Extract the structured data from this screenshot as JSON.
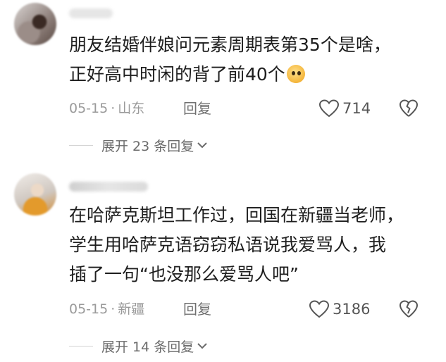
{
  "comments": [
    {
      "text_lines": [
        "朋友结婚伴娘问元素周期表第35个是啥，",
        "正好高中时闲的背了前40个"
      ],
      "emoji_icon": "grimace-emoji-icon",
      "date": "05-15",
      "dot": "·",
      "location": "山东",
      "reply_label": "回复",
      "likes": "714",
      "expand_label": "展开 23 条回复"
    },
    {
      "text_lines": [
        "在哈萨克斯坦工作过，回国在新疆当老师，",
        "学生用哈萨克语窃窃私语说我爱骂人，我",
        "插了一句“也没那么爱骂人吧”"
      ],
      "date": "05-15",
      "dot": "·",
      "location": "新疆",
      "reply_label": "回复",
      "likes": "3186",
      "expand_label": "展开 14 条回复"
    }
  ],
  "colors": {
    "text": "#1e1e1e",
    "meta": "#9a9a9a",
    "icon": "#555555"
  }
}
